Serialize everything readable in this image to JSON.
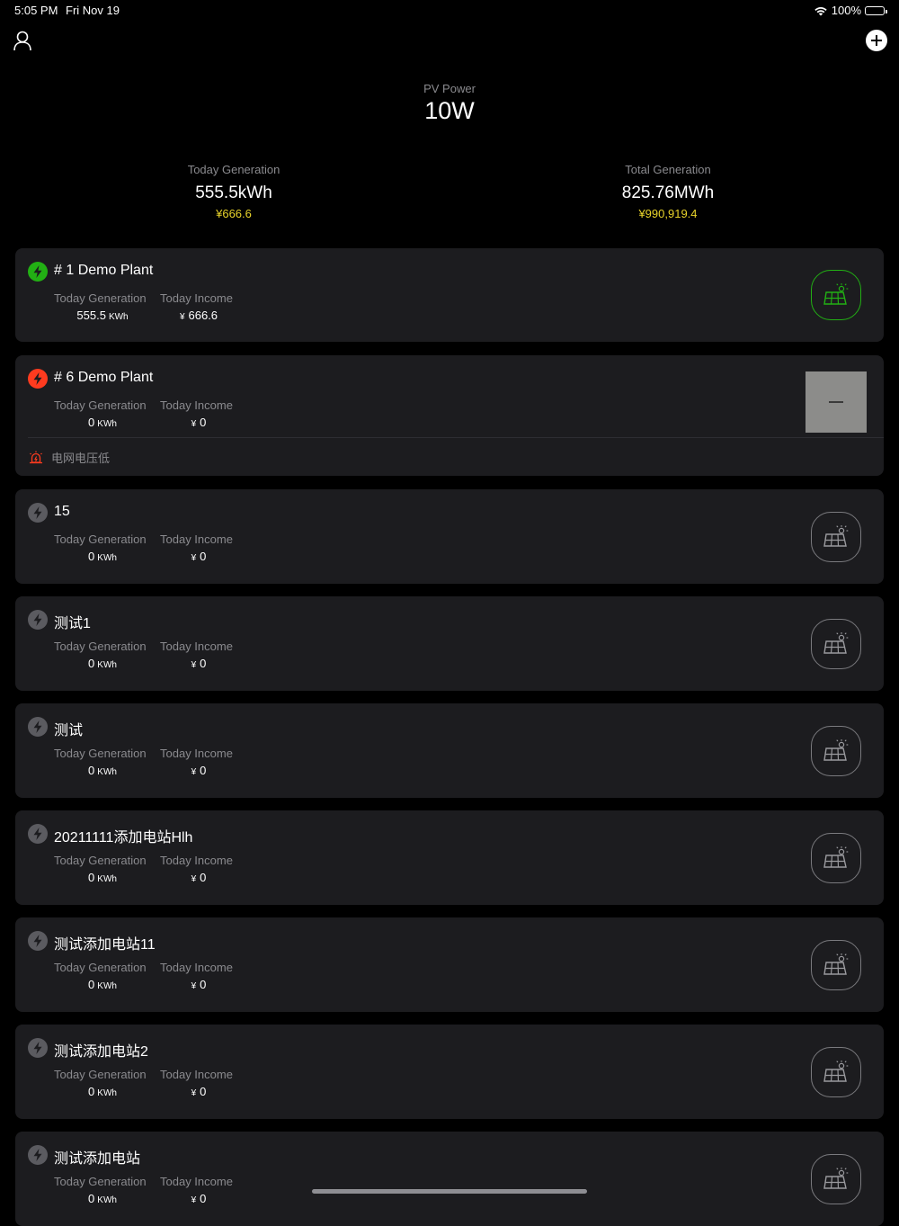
{
  "status_bar": {
    "time": "5:05 PM",
    "date": "Fri Nov 19",
    "battery": "100%"
  },
  "header": {
    "pv_label": "PV Power",
    "pv_value": "10W",
    "today": {
      "label": "Today Generation",
      "value": "555.5kWh",
      "money": "¥666.6"
    },
    "total": {
      "label": "Total Generation",
      "value": "825.76MWh",
      "money": "¥990,919.4"
    }
  },
  "colors": {
    "green": "#22b014",
    "red": "#ff3b1f",
    "gray": "#5b5b60",
    "yellow": "#e8d32a",
    "card_bg": "#1c1c1f"
  },
  "plants": [
    {
      "name": "# 1 Demo Plant",
      "status": "green",
      "gen_label": "Today Generation",
      "gen_value": "555.5",
      "gen_unit": "KWh",
      "income_label": "Today Income",
      "income_symbol": "¥",
      "income_value": "666.6",
      "visual": "icon-active"
    },
    {
      "name": "# 6 Demo Plant",
      "status": "red",
      "gen_label": "Today Generation",
      "gen_value": "0",
      "gen_unit": "KWh",
      "income_label": "Today Income",
      "income_symbol": "¥",
      "income_value": "0",
      "visual": "photo",
      "alarm": "电网电压低"
    },
    {
      "name": "15",
      "status": "gray",
      "gen_label": "Today Generation",
      "gen_value": "0",
      "gen_unit": "KWh",
      "income_label": "Today Income",
      "income_symbol": "¥",
      "income_value": "0",
      "visual": "icon"
    },
    {
      "name": "测试1",
      "status": "gray",
      "gen_label": "Today Generation",
      "gen_value": "0",
      "gen_unit": "KWh",
      "income_label": "Today Income",
      "income_symbol": "¥",
      "income_value": "0",
      "visual": "icon"
    },
    {
      "name": "测试",
      "status": "gray",
      "gen_label": "Today Generation",
      "gen_value": "0",
      "gen_unit": "KWh",
      "income_label": "Today Income",
      "income_symbol": "¥",
      "income_value": "0",
      "visual": "icon"
    },
    {
      "name": "20211111添加电站Hlh",
      "status": "gray",
      "gen_label": "Today Generation",
      "gen_value": "0",
      "gen_unit": "KWh",
      "income_label": "Today Income",
      "income_symbol": "¥",
      "income_value": "0",
      "visual": "icon"
    },
    {
      "name": "测试添加电站11",
      "status": "gray",
      "gen_label": "Today Generation",
      "gen_value": "0",
      "gen_unit": "KWh",
      "income_label": "Today Income",
      "income_symbol": "¥",
      "income_value": "0",
      "visual": "icon"
    },
    {
      "name": "测试添加电站2",
      "status": "gray",
      "gen_label": "Today Generation",
      "gen_value": "0",
      "gen_unit": "KWh",
      "income_label": "Today Income",
      "income_symbol": "¥",
      "income_value": "0",
      "visual": "icon"
    },
    {
      "name": "测试添加电站",
      "status": "gray",
      "gen_label": "Today Generation",
      "gen_value": "0",
      "gen_unit": "KWh",
      "income_label": "Today Income",
      "income_symbol": "¥",
      "income_value": "0",
      "visual": "icon"
    }
  ]
}
